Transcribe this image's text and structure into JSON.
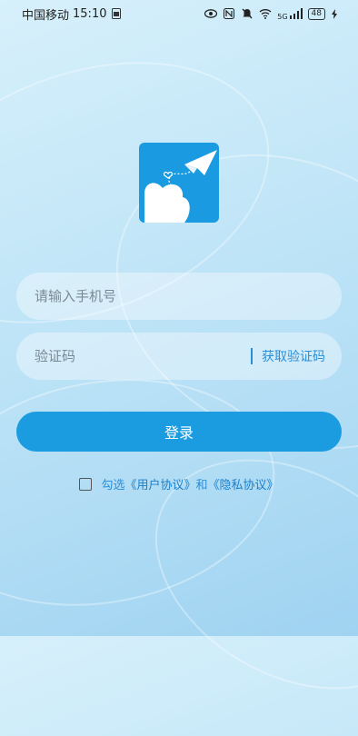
{
  "status_bar": {
    "carrier": "中国移动",
    "time": "15:10",
    "network": "5G",
    "battery": "48"
  },
  "login": {
    "phone_placeholder": "请输入手机号",
    "code_placeholder": "验证码",
    "get_code_label": "获取验证码",
    "login_label": "登录"
  },
  "agreement": {
    "prefix": "勾选",
    "user_agreement": "《用户协议》",
    "and": "和",
    "privacy_agreement": "《隐私协议》"
  },
  "colors": {
    "accent": "#1c9ce0",
    "logo_bg": "#1a9ae0"
  },
  "icons": {
    "logo": "paper-plane-cloud-logo"
  }
}
